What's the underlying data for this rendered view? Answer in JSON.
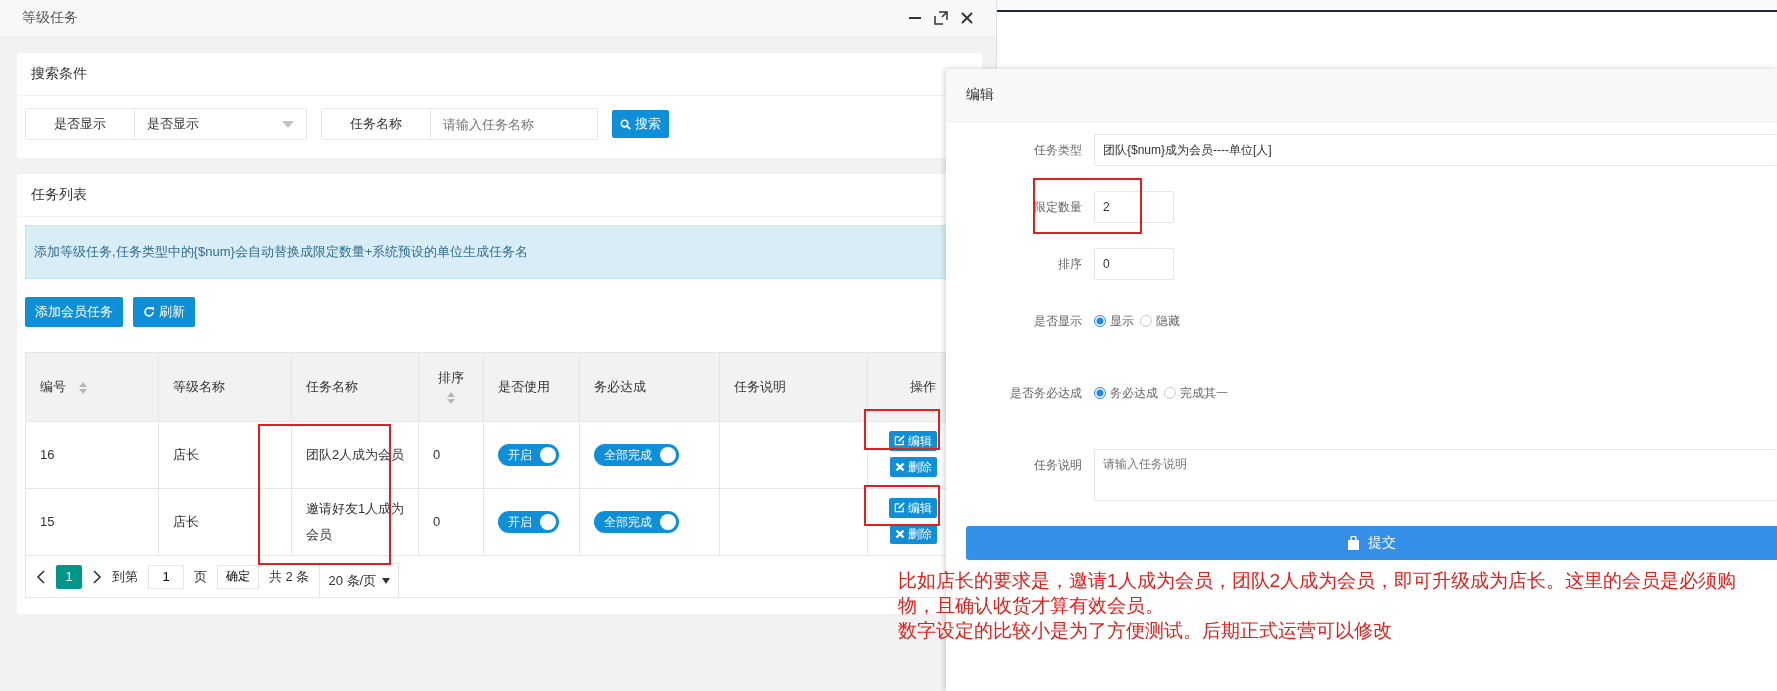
{
  "window": {
    "title": "等级任务"
  },
  "search": {
    "title": "搜索条件",
    "fields": [
      {
        "kind": "select",
        "label": "是否显示",
        "value": "是否显示"
      },
      {
        "kind": "text",
        "label": "任务名称",
        "placeholder": "请输入任务名称"
      }
    ],
    "button": "搜索"
  },
  "task_list": {
    "title": "任务列表",
    "notice": "添加等级任务,任务类型中的{$num}会自动替换成限定数量+系统预设的单位生成任务名",
    "buttons": [
      {
        "kind": "add",
        "label": "添加会员任务"
      },
      {
        "kind": "refresh",
        "label": "刷新"
      }
    ],
    "table": {
      "columns": [
        {
          "label": "编号",
          "sortable": true
        },
        {
          "label": "等级名称",
          "sortable": false
        },
        {
          "label": "任务名称",
          "sortable": false
        },
        {
          "label": "排序",
          "sortable": true
        },
        {
          "label": "是否使用",
          "sortable": false
        },
        {
          "label": "务必达成",
          "sortable": false
        },
        {
          "label": "任务说明",
          "sortable": false
        },
        {
          "label": "操作",
          "sortable": false
        }
      ],
      "rows": [
        {
          "id": "16",
          "level": "店长",
          "name": "团队2人成为会员",
          "sort": "0",
          "enabled": {
            "label": "开启",
            "on": true
          },
          "required": {
            "label": "全部完成",
            "on": true
          },
          "edit": "编辑",
          "delete": "删除"
        },
        {
          "id": "15",
          "level": "店长",
          "name": "邀请好友1人成为会员",
          "sort": "0",
          "enabled": {
            "label": "开启",
            "on": true
          },
          "required": {
            "label": "全部完成",
            "on": true
          },
          "edit": "编辑",
          "delete": "删除"
        }
      ]
    },
    "pagination": {
      "pages": [
        {
          "label": "1",
          "selected": true
        }
      ],
      "goto_label": "到第",
      "goto_value": "1",
      "page_unit": "页",
      "confirm": "确定",
      "total": "共 2 条",
      "page_size": "20 条/页"
    }
  },
  "edit_panel": {
    "title": "编辑",
    "fields": [
      {
        "kind": "text",
        "label": "任务类型",
        "value": "团队{$num}成为会员----单位[人]"
      },
      {
        "kind": "number",
        "label": "限定数量",
        "value": "2"
      },
      {
        "kind": "number",
        "label": "排序",
        "value": "0"
      },
      {
        "kind": "radio",
        "label": "是否显示",
        "options": [
          {
            "label": "显示",
            "selected": true
          },
          {
            "label": "隐藏",
            "selected": false
          }
        ]
      },
      {
        "kind": "radio",
        "label": "是否务必达成",
        "options": [
          {
            "label": "务必达成",
            "selected": true
          },
          {
            "label": "完成其一",
            "selected": false
          }
        ]
      },
      {
        "kind": "textarea",
        "label": "任务说明",
        "placeholder": "请输入任务说明"
      }
    ],
    "submit": "提交"
  },
  "annotation": {
    "paragraphs": [
      "比如店长的要求是，邀请1人成为会员，团队2人成为会员，即可升级成为店长。这里的会员是必须购物，且确认收货才算有效会员。",
      "数字设定的比较小是为了方便测试。后期正式运营可以修改"
    ]
  }
}
